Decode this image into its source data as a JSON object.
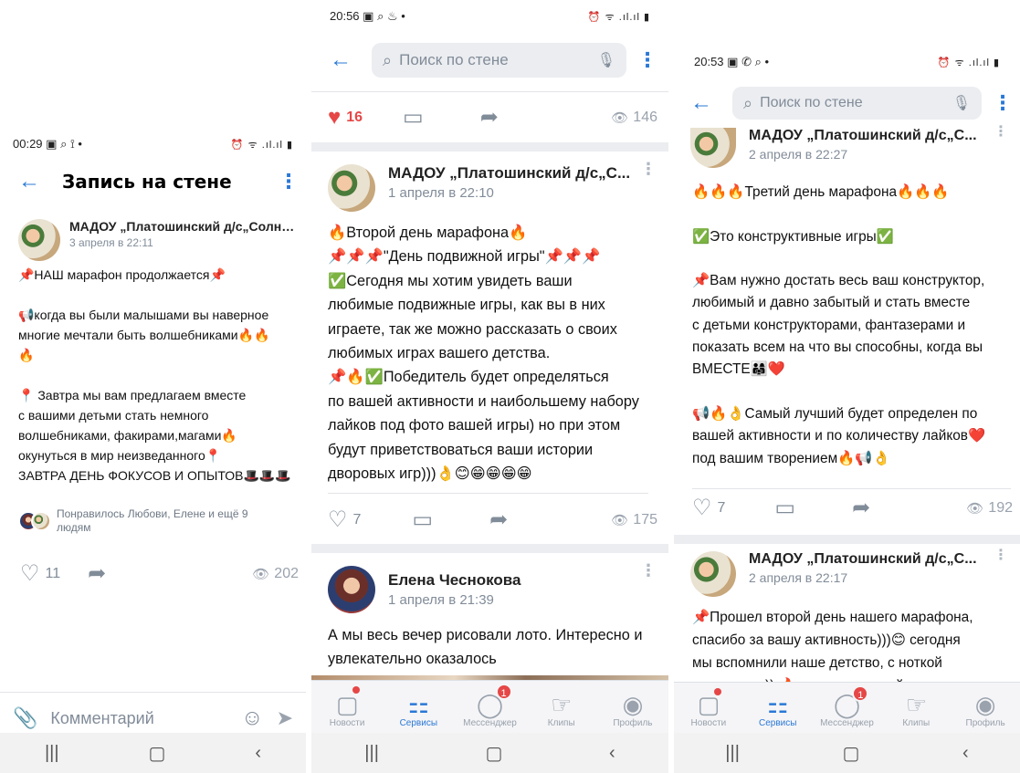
{
  "screen1": {
    "status_time": "00:29",
    "status_left_icons": "▣ ⌕ ⟟ •",
    "status_right_icons": "⏰ ᯤ .ıl.ıl ▮",
    "title": "Запись на стене",
    "author": "МАДОУ „Платошинский д/с„Солны...",
    "date": "3 апреля в 22:11",
    "lines": [
      "📌НАШ марафон продолжается📌",
      "",
      "📢когда вы были малышами вы наверное",
      "многие мечтали быть волшебниками🔥🔥",
      "🔥",
      "",
      "📍 Завтра мы вам предлагаем вместе",
      "с вашими детьми стать немного",
      "волшебниками, факирами,магами🔥",
      "окунуться в мир неизведанного📍",
      "ЗАВТРА ДЕНЬ ФОКУСОВ И ОПЫТОВ🎩🎩🎩"
    ],
    "liked_by": [
      "Понравилось Любови, Елене и ещё 9",
      "людям"
    ],
    "likes": "11",
    "views": "202",
    "comment_placeholder": "Комментарий"
  },
  "screen2": {
    "status_time": "20:56",
    "status_left_icons": "▣ ⌕ ♨ •",
    "status_right_icons": "⏰ ᯤ .ıl.ıl ▮",
    "search_placeholder": "Поиск по стене",
    "top_likes": "16",
    "top_views": "146",
    "post1": {
      "author": "МАДОУ „Платошинский д/с„С...",
      "date": "1 апреля в 22:10",
      "lines": [
        "🔥Второй день марафона🔥",
        "📌📌📌\"День подвижной игры\"📌📌📌",
        "✅Сегодня мы хотим увидеть ваши",
        "любимые подвижные игры, как вы в них",
        "играете, так же можно рассказать о своих",
        "любимых играх вашего детства.",
        " 📌🔥✅Победитель будет определяться",
        "по вашей активности и наибольшему набору",
        "лайков под фото вашей игры) но при этом",
        "будут приветствоваться ваши истории",
        "дворовых игр)))👌😊😁😁😁😁"
      ],
      "likes": "7",
      "views": "175"
    },
    "post2": {
      "author": "Елена Чеснокова",
      "date": "1 апреля в 21:39",
      "lines": [
        "А мы весь вечер рисовали лото. Интересно и",
        "увлекательно оказалось"
      ]
    }
  },
  "screen3": {
    "status_time": "20:53",
    "status_left_icons": "▣ ✆ ⌕ •",
    "status_right_icons": "⏰ ᯤ .ıl.ıl ▮",
    "search_placeholder": "Поиск по стене",
    "post1": {
      "author": "МАДОУ „Платошинский д/с„С...",
      "date": "2 апреля в 22:27",
      "lines": [
        "🔥🔥🔥Третий день марафона🔥🔥🔥",
        "",
        "✅Это конструктивные игры✅",
        "",
        "📌Вам нужно достать весь ваш конструктор,",
        "любимый и давно забытый и стать вместе",
        "с детьми конструкторами, фантазерами и",
        "показать всем на что вы способны, когда вы",
        "ВМЕСТЕ👨‍👩‍👧❤️",
        "",
        "📢🔥👌Самый лучший будет определен по",
        "вашей активности и по количеству лайков❤️",
        "под вашим творением🔥📢👌"
      ],
      "likes": "7",
      "views": "192"
    },
    "post2": {
      "author": "МАДОУ „Платошинский д/с„С...",
      "date": "2 апреля в 22:17",
      "lines": [
        "📌Прошел второй день нашего марафона,",
        "спасибо за вашу активность)))😊 сегодня",
        "мы вспомнили наше детство, с ноткой",
        "ностальгии)) 🔥 за сегодняшний день ваши"
      ]
    }
  },
  "tabbar": {
    "tabs": [
      {
        "label": "Новости",
        "icon": "news-icon"
      },
      {
        "label": "Сервисы",
        "icon": "services-icon"
      },
      {
        "label": "Мессенджер",
        "icon": "messenger-icon",
        "badge": "1"
      },
      {
        "label": "Клипы",
        "icon": "clips-icon"
      },
      {
        "label": "Профиль",
        "icon": "profile-icon"
      }
    ]
  },
  "colors": {
    "accent": "#2a78d6",
    "like_red": "#e64646",
    "secondary_text": "#818c99",
    "separator": "#ebedf0"
  }
}
